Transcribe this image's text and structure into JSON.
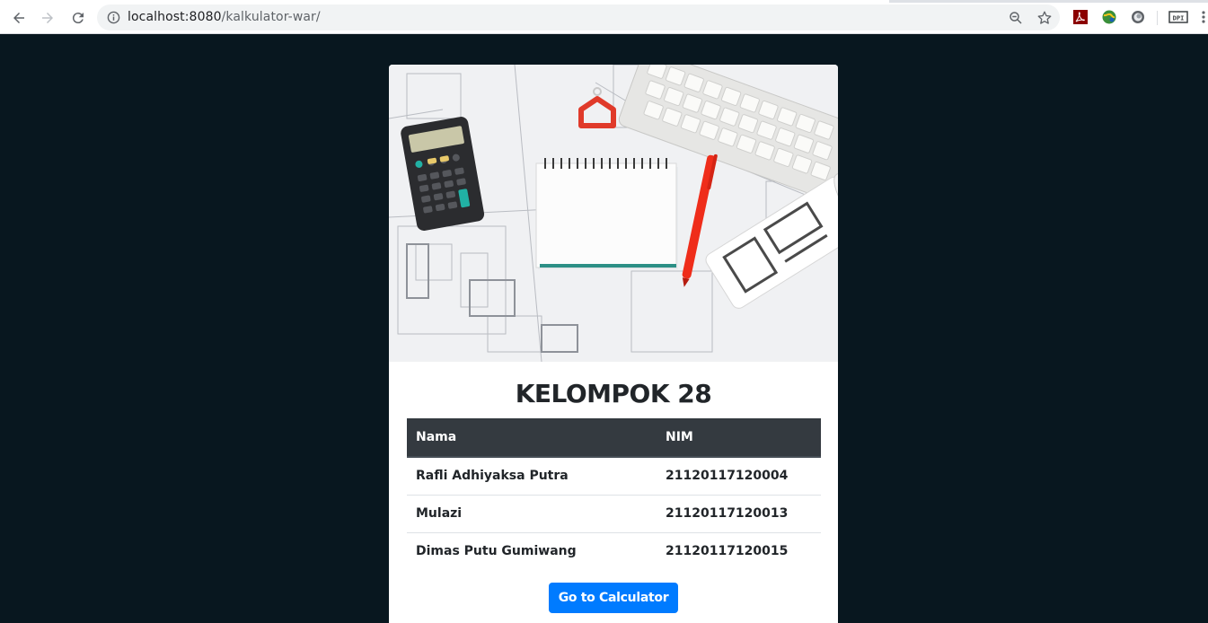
{
  "browser": {
    "url_host": "localhost:8080",
    "url_path": "/kalkulator-war/",
    "icons": [
      "back-icon",
      "forward-icon",
      "reload-icon",
      "info-icon",
      "zoom-icon",
      "star-icon",
      "pdf-extension-icon",
      "globe-extension-icon",
      "circle-extension-icon",
      "dpi-extension-icon",
      "menu-icon"
    ],
    "dpi_label": "DPI"
  },
  "page": {
    "background": "#08171f",
    "title": "KELOMPOK 28",
    "table": {
      "headers": [
        "Nama",
        "NIM"
      ],
      "rows": [
        [
          "Rafli Adhiyaksa Putra",
          "21120117120004"
        ],
        [
          "Mulazi",
          "21120117120013"
        ],
        [
          "Dimas Putu Gumiwang",
          "21120117120015"
        ]
      ]
    },
    "button_label": "Go to Calculator",
    "button_color": "#007bff",
    "table_header_color": "#343a40"
  }
}
